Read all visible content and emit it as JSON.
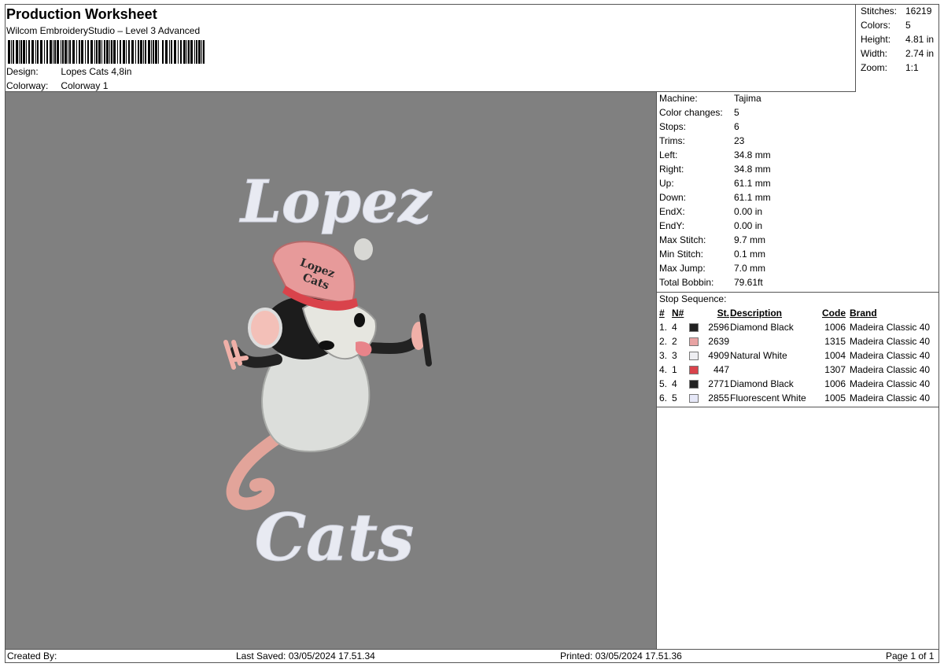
{
  "header": {
    "title": "Production Worksheet",
    "subtitle": "Wilcom EmbroideryStudio – Level 3 Advanced",
    "design_label": "Design:",
    "design_value": "Lopes Cats 4,8in",
    "colorway_label": "Colorway:",
    "colorway_value": "Colorway 1"
  },
  "summary": [
    {
      "label": "Stitches:",
      "value": "16219"
    },
    {
      "label": "Colors:",
      "value": "5"
    },
    {
      "label": "Height:",
      "value": "4.81 in"
    },
    {
      "label": "Width:",
      "value": "2.74 in"
    },
    {
      "label": "Zoom:",
      "value": "1:1"
    }
  ],
  "machine_info": [
    {
      "label": "Machine:",
      "value": "Tajima"
    },
    {
      "label": "Color changes:",
      "value": "5"
    },
    {
      "label": "Stops:",
      "value": "6"
    },
    {
      "label": "Trims:",
      "value": "23"
    },
    {
      "label": "Left:",
      "value": "34.8 mm"
    },
    {
      "label": "Right:",
      "value": "34.8 mm"
    },
    {
      "label": "Up:",
      "value": "61.1 mm"
    },
    {
      "label": "Down:",
      "value": "61.1 mm"
    },
    {
      "label": "EndX:",
      "value": "0.00 in"
    },
    {
      "label": "EndY:",
      "value": "0.00 in"
    },
    {
      "label": "Max Stitch:",
      "value": "9.7 mm"
    },
    {
      "label": "Min Stitch:",
      "value": "0.1 mm"
    },
    {
      "label": "Max Jump:",
      "value": "7.0 mm"
    },
    {
      "label": "Total Bobbin:",
      "value": "79.61ft"
    }
  ],
  "stop_sequence": {
    "title": "Stop Sequence:",
    "headers": {
      "num": "#",
      "n": "N#",
      "st": "St.",
      "description": "Description",
      "code": "Code",
      "brand": "Brand"
    },
    "rows": [
      {
        "num": "1.",
        "n": "4",
        "color": "#222222",
        "st": "2596",
        "description": "Diamond Black",
        "code": "1006",
        "brand": "Madeira Classic 40"
      },
      {
        "num": "2.",
        "n": "2",
        "color": "#e8a3a3",
        "st": "2639",
        "description": "",
        "code": "1315",
        "brand": "Madeira Classic 40"
      },
      {
        "num": "3.",
        "n": "3",
        "color": "#eeeef2",
        "st": "4909",
        "description": "Natural White",
        "code": "1004",
        "brand": "Madeira Classic 40"
      },
      {
        "num": "4.",
        "n": "1",
        "color": "#d9434b",
        "st": "447",
        "description": "",
        "code": "1307",
        "brand": "Madeira Classic 40"
      },
      {
        "num": "5.",
        "n": "4",
        "color": "#222222",
        "st": "2771",
        "description": "Diamond Black",
        "code": "1006",
        "brand": "Madeira Classic 40"
      },
      {
        "num": "6.",
        "n": "5",
        "color": "#e6e8f8",
        "st": "2855",
        "description": "Fluorescent White",
        "code": "1005",
        "brand": "Madeira Classic 40"
      }
    ]
  },
  "design_preview": {
    "text_top": "Lopez",
    "text_bottom": "Cats",
    "cap_text_1": "Lopez",
    "cap_text_2": "Cats",
    "background": "#808080"
  },
  "footer": {
    "created_by": "Created By:",
    "last_saved": "Last Saved: 03/05/2024 17.51.34",
    "printed": "Printed: 03/05/2024 17.51.36",
    "page": "Page 1 of 1"
  }
}
